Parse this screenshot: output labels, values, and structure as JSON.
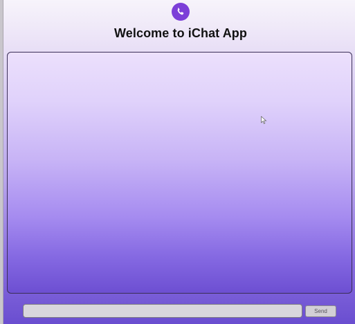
{
  "app": {
    "logo_icon": "whatsapp-phone-icon",
    "title": "Welcome to iChat App"
  },
  "colors": {
    "accent": "#7c3fd8",
    "chat_top": "#ece0fc",
    "chat_bottom": "#6d4fd2"
  },
  "composer": {
    "input_value": "",
    "input_placeholder": "",
    "send_label": "Send"
  }
}
